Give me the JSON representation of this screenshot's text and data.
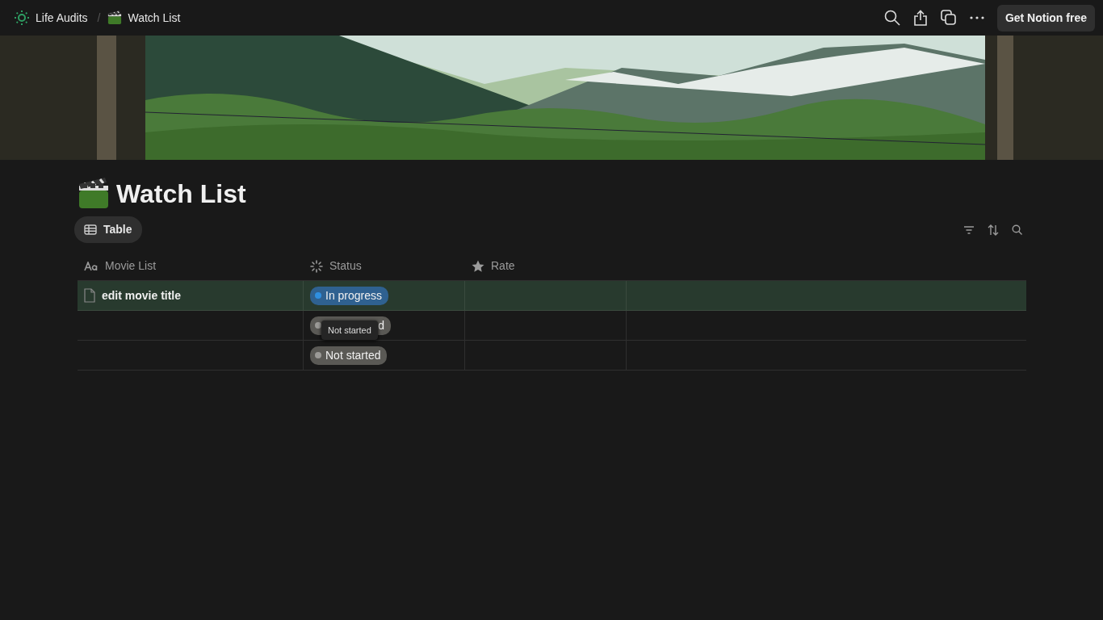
{
  "breadcrumb": [
    {
      "label": "Life Audits"
    },
    {
      "label": "Watch List"
    }
  ],
  "breadcrumb_separator": "/",
  "topbar": {
    "cta": "Get Notion free"
  },
  "page": {
    "title": "Watch List"
  },
  "views": [
    {
      "label": "Table",
      "selected": true
    }
  ],
  "table": {
    "columns": [
      {
        "label": "Movie List"
      },
      {
        "label": "Status"
      },
      {
        "label": "Rate"
      }
    ],
    "rows": [
      {
        "selected": true,
        "title": "edit movie title",
        "status": {
          "label": "In progress",
          "color": "#2f8fe0"
        }
      },
      {
        "selected": false,
        "status": {
          "label": "d",
          "color": "#9b9a97"
        },
        "tooltip": "Not started"
      },
      {
        "selected": false,
        "status": {
          "label": "Not started",
          "color": "#9b9a97"
        }
      }
    ]
  }
}
